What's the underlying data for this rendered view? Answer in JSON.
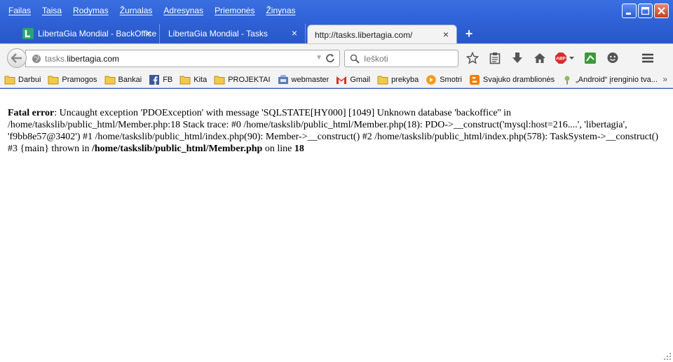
{
  "menu": [
    "Failas",
    "Taisa",
    "Rodymas",
    "Žurnalas",
    "Adresynas",
    "Priemonės",
    "Žinynas"
  ],
  "tabs": [
    {
      "label": "LibertaGia Mondial - BackOffice",
      "active": false
    },
    {
      "label": "LibertaGia Mondial - Tasks",
      "active": false
    },
    {
      "label": "http://tasks.libertagia.com/",
      "active": true
    }
  ],
  "urlbar": {
    "prefix": "tasks.",
    "host": "libertagia.com"
  },
  "search": {
    "placeholder": "Ieškoti"
  },
  "bookmarks": [
    {
      "label": "Darbui",
      "icon": "folder-icon"
    },
    {
      "label": "Pramogos",
      "icon": "folder-icon"
    },
    {
      "label": "Bankai",
      "icon": "folder-icon"
    },
    {
      "label": "FB",
      "icon": "facebook-icon"
    },
    {
      "label": "Kita",
      "icon": "folder-icon"
    },
    {
      "label": "PROJEKTAI",
      "icon": "folder-icon"
    },
    {
      "label": "webmaster",
      "icon": "webmaster-icon"
    },
    {
      "label": "Gmail",
      "icon": "gmail-icon"
    },
    {
      "label": "prekyba",
      "icon": "folder-icon"
    },
    {
      "label": "Smotri",
      "icon": "smotri-icon"
    },
    {
      "label": "Svajuko dramblionės",
      "icon": "blogger-icon"
    },
    {
      "label": "„Android“ įrenginio tva...",
      "icon": "android-icon"
    }
  ],
  "bookmarks_more": "»",
  "error": {
    "label": "Fatal error",
    "message": ": Uncaught exception 'PDOException' with message 'SQLSTATE[HY000] [1049] Unknown database 'backoffice'' in /home/taskslib/public_html/Member.php:18 Stack trace: #0 /home/taskslib/public_html/Member.php(18): PDO->__construct('mysql:host=216....', 'libertagia', 'f9bb8e57@3402') #1 /home/taskslib/public_html/index.php(90): Member->__construct() #2 /home/taskslib/public_html/index.php(578): TaskSystem->__construct() #3 {main} thrown in ",
    "file": "/home/taskslib/public_html/Member.php",
    "line_prefix": " on line ",
    "line": "18"
  },
  "colors": {
    "titlebar": "#2f63d8",
    "chrome": "#f3f3f3",
    "content": "#ffffff"
  }
}
